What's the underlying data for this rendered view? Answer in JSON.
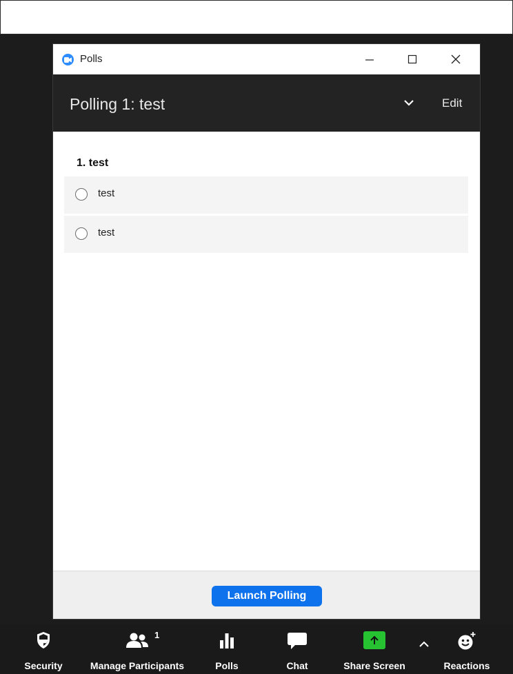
{
  "window": {
    "title": "Polls"
  },
  "poll": {
    "title": "Polling 1: test",
    "edit_label": "Edit",
    "question": "1. test",
    "options": [
      "test",
      "test"
    ]
  },
  "footer": {
    "launch_label": "Launch Polling"
  },
  "toolbar": {
    "items": [
      {
        "label": "Security",
        "icon": "shield-icon"
      },
      {
        "label": "Manage Participants",
        "icon": "participants-icon",
        "count": "1"
      },
      {
        "label": "Polls",
        "icon": "polls-icon"
      },
      {
        "label": "Chat",
        "icon": "chat-icon"
      },
      {
        "label": "Share Screen",
        "icon": "share-screen-icon"
      },
      {
        "label": "Reactions",
        "icon": "reactions-icon"
      }
    ]
  },
  "colors": {
    "accent": "#0e72ed",
    "share_green": "#26c232",
    "header_dark": "#232323",
    "toolbar_dark": "#1a1a1a"
  }
}
